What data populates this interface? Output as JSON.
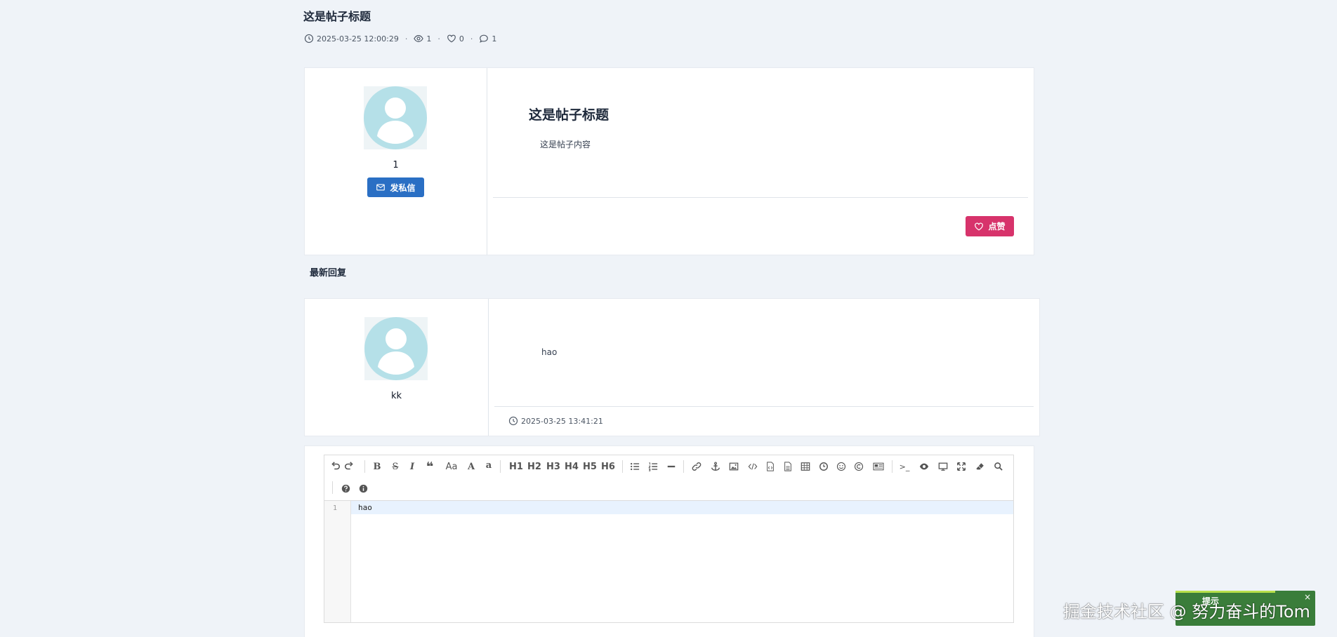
{
  "post": {
    "title": "这是帖子标题",
    "datetime": "2025-03-25 12:00:29",
    "views": "1",
    "likes": "0",
    "comments": "1",
    "author_name": "1",
    "pm_label": "发私信",
    "heading": "这是帖子标题",
    "content": "这是帖子内容",
    "like_label": "点赞"
  },
  "replies": {
    "section_title": "最新回复",
    "items": [
      {
        "author": "kk",
        "content": "hao",
        "datetime": "2025-03-25 13:41:21"
      }
    ]
  },
  "editor": {
    "toolbar": {
      "fontsize_label": "Aa",
      "upper_label": "A",
      "lower_label": "a",
      "h1": "H1",
      "h2": "H2",
      "h3": "H3",
      "h4": "H4",
      "h5": "H5",
      "h6": "H6",
      "terminal_label": ">_"
    },
    "line_number": "1",
    "content": "hao"
  },
  "overlay": {
    "watermark": "掘金技术社区 @ 努力奋斗的Tom",
    "toast_title": "提示",
    "toast_close": "×"
  },
  "colors": {
    "background": "#eff3f8",
    "pm_button": "#2a6fc4",
    "like_button": "#d7336b",
    "toast": "#3a7d3a"
  }
}
